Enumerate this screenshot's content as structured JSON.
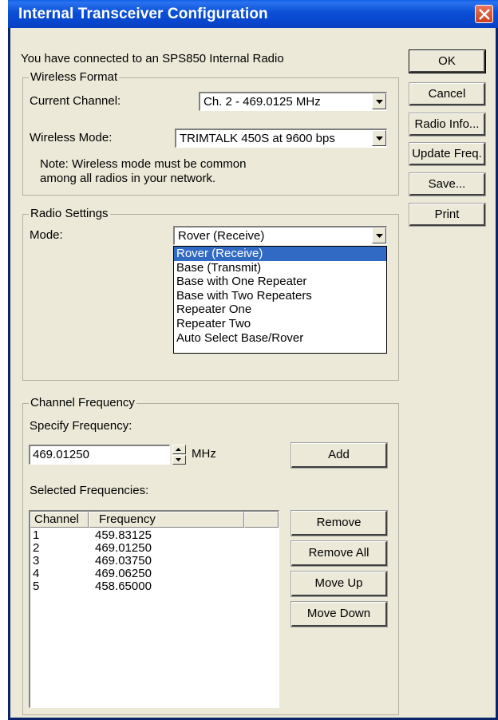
{
  "window": {
    "title": "Internal Transceiver Configuration",
    "close_icon": "close-icon"
  },
  "connected_text": "You have connected to an SPS850 Internal Radio",
  "buttons": {
    "ok": "OK",
    "cancel": "Cancel",
    "radio_info": "Radio Info...",
    "update_freq": "Update Freq.",
    "save": "Save...",
    "print": "Print"
  },
  "wireless_format": {
    "group_label": "Wireless Format",
    "channel_label": "Current Channel:",
    "channel_value": "Ch.  2 - 469.0125 MHz",
    "mode_label": "Wireless Mode:",
    "mode_value": "TRIMTALK 450S at 9600 bps",
    "note_line1": "Note: Wireless mode must be common",
    "note_line2": "among all radios in your network."
  },
  "radio_settings": {
    "group_label": "Radio Settings",
    "mode_label": "Mode:",
    "mode_value": "Rover (Receive)",
    "options": [
      "Rover (Receive)",
      "Base (Transmit)",
      "Base with One Repeater",
      "Base with Two Repeaters",
      "Repeater One",
      "Repeater Two",
      "Auto Select Base/Rover"
    ],
    "highlighted_option": "Rover (Receive)"
  },
  "channel_frequency": {
    "group_label": "Channel Frequency",
    "specify_label": "Specify Frequency:",
    "frequency_value": "469.01250",
    "unit": "MHz",
    "add_label": "Add",
    "selected_label": "Selected Frequencies:",
    "columns": [
      "Channel",
      "Frequency"
    ],
    "rows": [
      {
        "channel": "1",
        "frequency": "459.83125"
      },
      {
        "channel": "2",
        "frequency": "469.01250"
      },
      {
        "channel": "3",
        "frequency": "469.03750"
      },
      {
        "channel": "4",
        "frequency": "469.06250"
      },
      {
        "channel": "5",
        "frequency": "458.65000"
      }
    ],
    "remove_label": "Remove",
    "remove_all_label": "Remove All",
    "move_up_label": "Move Up",
    "move_down_label": "Move Down"
  },
  "colors": {
    "titlebar": "#0a4fd6",
    "dialog_bg": "#ece9d8",
    "selection": "#316ac5",
    "close_button": "#d9552f"
  }
}
